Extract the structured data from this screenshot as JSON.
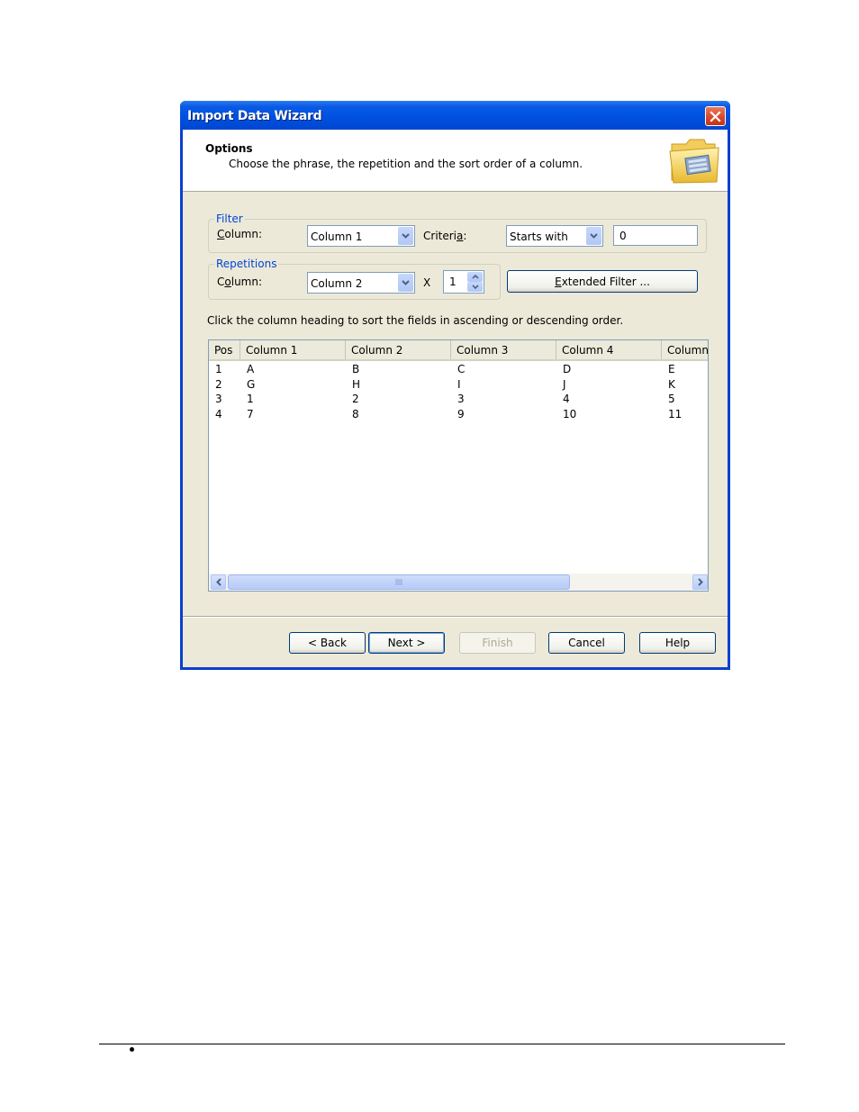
{
  "window": {
    "title": "Import Data Wizard",
    "close_label": "✕"
  },
  "header": {
    "title": "Options",
    "subtitle": "Choose the phrase, the repetition and the sort order of a column.",
    "icon": "folder-icon"
  },
  "filter": {
    "group_label": "Filter",
    "column_label": "Column:",
    "column_value": "Column 1",
    "criteria_label": "Criteria:",
    "criteria_value": "Starts with",
    "text_value": "0"
  },
  "repetitions": {
    "group_label": "Repetitions",
    "column_label": "Column:",
    "column_value": "Column 2",
    "times_label": "X",
    "count_value": "1"
  },
  "extended_filter_label": "Extended Filter ...",
  "sort_hint": "Click the column heading to sort the fields in ascending or descending order.",
  "table": {
    "headers": [
      "Pos",
      "Column 1",
      "Column 2",
      "Column 3",
      "Column 4",
      "Column"
    ],
    "rows": [
      [
        "1",
        "A",
        "B",
        "C",
        "D",
        "E"
      ],
      [
        "2",
        "G",
        "H",
        "I",
        "J",
        "K"
      ],
      [
        "3",
        "1",
        "2",
        "3",
        "4",
        "5"
      ],
      [
        "4",
        "7",
        "8",
        "9",
        "10",
        "11"
      ]
    ]
  },
  "buttons": {
    "back": "< Back",
    "next": "Next >",
    "finish": "Finish",
    "cancel": "Cancel",
    "help": "Help"
  },
  "colors": {
    "titlebar": "#0050e0",
    "dialog_bg": "#ece9d8",
    "group_label": "#0046d5"
  }
}
